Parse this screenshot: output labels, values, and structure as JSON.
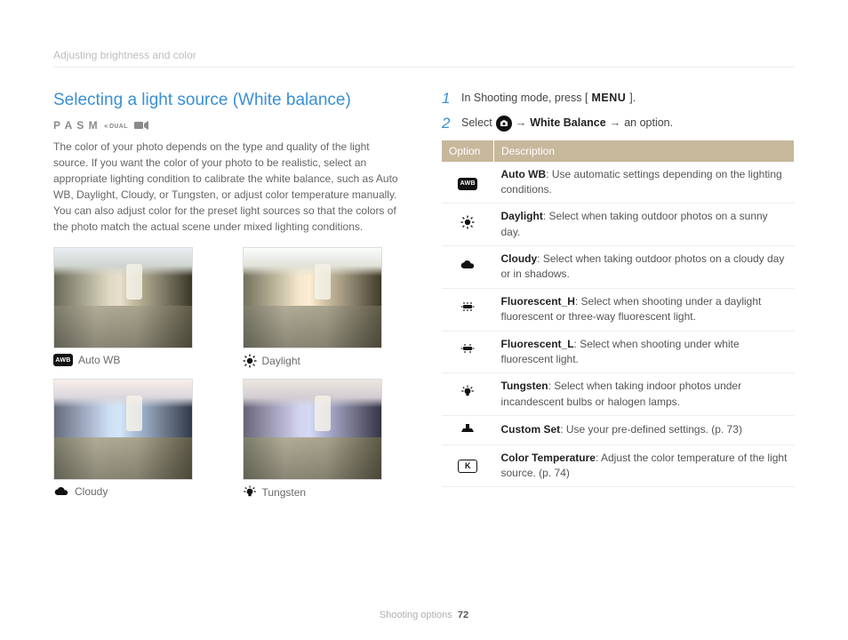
{
  "breadcrumb": "Adjusting brightness and color",
  "section_title": "Selecting a light source (White balance)",
  "mode_letters": "P A S M",
  "mode_dual": "DUAL",
  "intro": "The color of your photo depends on the type and quality of the light source. If you want the color of your photo to be realistic, select an appropriate lighting condition to calibrate the white balance, such as Auto WB, Daylight, Cloudy, or Tungsten, or adjust color temperature manually. You can also adjust color for the preset light sources so that the colors of the photo match the actual scene under mixed lighting conditions.",
  "thumbs": [
    {
      "icon": "awb",
      "label": "Auto WB"
    },
    {
      "icon": "sun",
      "label": "Daylight"
    },
    {
      "icon": "cloud",
      "label": "Cloudy"
    },
    {
      "icon": "tungsten",
      "label": "Tungsten"
    }
  ],
  "steps": {
    "one_a": "In Shooting mode, press [",
    "one_menu": "MENU",
    "one_b": "].",
    "two_a": "Select",
    "two_arrow1": "→",
    "two_wb": "White Balance",
    "two_arrow2": "→",
    "two_b": "an option."
  },
  "table": {
    "col_option": "Option",
    "col_desc": "Description",
    "rows": [
      {
        "icon": "awb",
        "name": "Auto WB",
        "desc": ": Use automatic settings depending on the lighting conditions."
      },
      {
        "icon": "sun",
        "name": "Daylight",
        "desc": ": Select when taking outdoor photos on a sunny day."
      },
      {
        "icon": "cloud",
        "name": "Cloudy",
        "desc": ": Select when taking outdoor photos on a cloudy day or in shadows."
      },
      {
        "icon": "flh",
        "name": "Fluorescent_H",
        "desc": ": Select when shooting under a daylight fluorescent or three-way fluorescent light."
      },
      {
        "icon": "fll",
        "name": "Fluorescent_L",
        "desc": ": Select when shooting under white fluorescent light."
      },
      {
        "icon": "tungsten",
        "name": "Tungsten",
        "desc": ": Select when taking indoor photos under incandescent bulbs or halogen lamps."
      },
      {
        "icon": "custom",
        "name": "Custom Set",
        "desc": ": Use your pre-defined settings. (p. 73)"
      },
      {
        "icon": "kelvin",
        "name": "Color Temperature",
        "desc": ": Adjust the color temperature of the light source. (p. 74)"
      }
    ]
  },
  "footer_section": "Shooting options",
  "footer_page": "72"
}
